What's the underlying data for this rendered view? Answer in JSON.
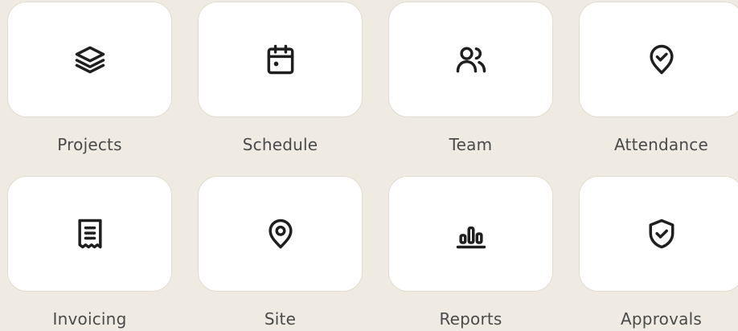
{
  "tiles": [
    {
      "label": "Projects",
      "icon": "layers-icon"
    },
    {
      "label": "Schedule",
      "icon": "calendar-icon"
    },
    {
      "label": "Team",
      "icon": "users-icon"
    },
    {
      "label": "Attendance",
      "icon": "location-check-icon"
    },
    {
      "label": "Invoicing",
      "icon": "receipt-icon"
    },
    {
      "label": "Site",
      "icon": "map-pin-icon"
    },
    {
      "label": "Reports",
      "icon": "bar-chart-icon"
    },
    {
      "label": "Approvals",
      "icon": "shield-check-icon"
    }
  ],
  "colors": {
    "background": "#efebe3",
    "card": "#ffffff",
    "card_border": "#e3dccd",
    "icon": "#1f1f1f",
    "label": "#4a4a4a"
  }
}
